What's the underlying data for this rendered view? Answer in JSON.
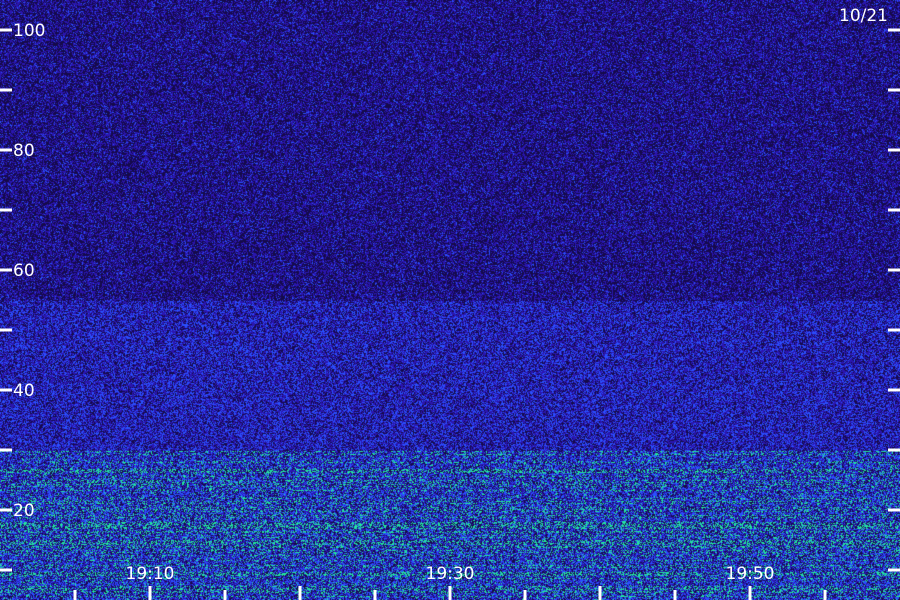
{
  "chart_data": {
    "type": "heatmap",
    "date": "10/21",
    "x_axis": {
      "range": [
        "19:00",
        "20:00"
      ],
      "major_ticks": [
        "19:10",
        "19:20",
        "19:30",
        "19:40",
        "19:50",
        "20:00"
      ],
      "labels": [
        "19:10",
        "19:30",
        "19:50"
      ],
      "minor_tick_interval_minutes": 5
    },
    "y_axis": {
      "range": [
        0,
        100
      ],
      "ticks": [
        0,
        10,
        20,
        30,
        40,
        50,
        60,
        70,
        80,
        90,
        100
      ],
      "labels": [
        "20",
        "40",
        "60",
        "80",
        "100"
      ]
    },
    "intensity_bands": [
      {
        "from": 0,
        "to": 30,
        "level": "high"
      },
      {
        "from": 30,
        "to": 55,
        "level": "medium"
      },
      {
        "from": 55,
        "to": 100,
        "level": "low"
      }
    ],
    "colors": {
      "background": "#150a4a",
      "low": "#2a16b0",
      "medium": "#2a50ff",
      "high": "#22e6a0",
      "axis": "#ffffff"
    },
    "grid": false
  }
}
